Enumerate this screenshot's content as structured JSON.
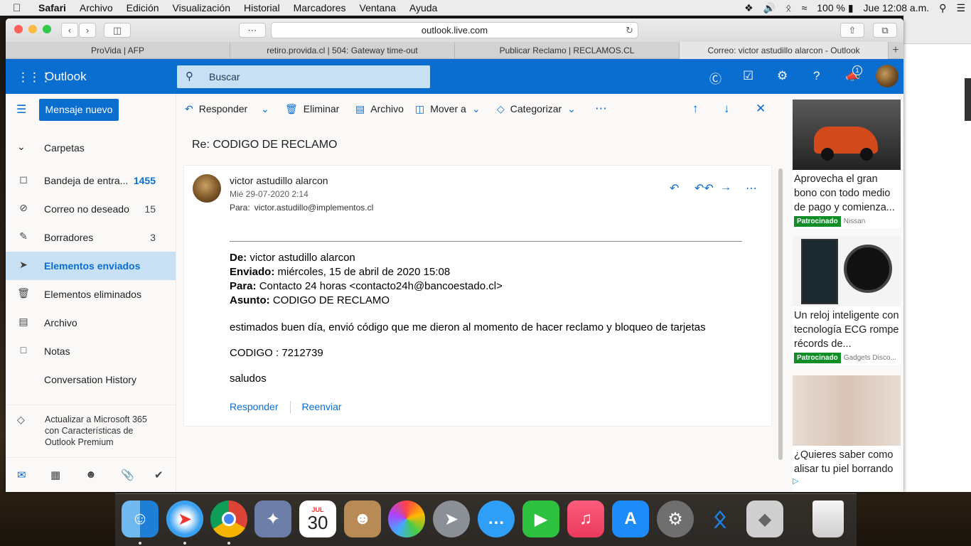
{
  "menubar": {
    "app": "Safari",
    "items": [
      "Archivo",
      "Edición",
      "Visualización",
      "Historial",
      "Marcadores",
      "Ventana",
      "Ayuda"
    ],
    "battery": "100 %",
    "clock": "Jue 12:08 a.m."
  },
  "browser": {
    "url": "outlook.live.com",
    "tabs": [
      {
        "label": "ProVida | AFP"
      },
      {
        "label": "retiro.provida.cl | 504: Gateway time-out"
      },
      {
        "label": "Publicar Reclamo | RECLAMOS.CL"
      },
      {
        "label": "Correo: victor astudillo alarcon - Outlook"
      }
    ]
  },
  "outlook": {
    "brand": "Outlook",
    "search_placeholder": "Buscar",
    "notification_count": "1",
    "new_message": "Mensaje nuevo",
    "folders_header": "Carpetas",
    "folders": [
      {
        "label": "Bandeja de entra...",
        "count": "1455"
      },
      {
        "label": "Correo no deseado",
        "count": "15"
      },
      {
        "label": "Borradores",
        "count": "3"
      },
      {
        "label": "Elementos enviados",
        "count": ""
      },
      {
        "label": "Elementos eliminados",
        "count": ""
      },
      {
        "label": "Archivo",
        "count": ""
      },
      {
        "label": "Notas",
        "count": ""
      },
      {
        "label": "Conversation History",
        "count": ""
      }
    ],
    "upgrade": "Actualizar a Microsoft 365 con Características de Outlook Premium",
    "commands": {
      "reply": "Responder",
      "delete": "Eliminar",
      "archive": "Archivo",
      "move": "Mover a",
      "categorize": "Categorizar"
    }
  },
  "message": {
    "subject": "Re: CODIGO DE RECLAMO",
    "sender": "victor astudillo alarcon",
    "date": "Mié 29-07-2020 2:14",
    "to_label": "Para:",
    "to": "victor.astudillo@implementos.cl",
    "quoted": {
      "from_label": "De:",
      "from": "victor astudillo alarcon",
      "sent_label": "Enviado:",
      "sent": "miércoles, 15 de abril de 2020 15:08",
      "to_label": "Para:",
      "to": "Contacto 24 horas <contacto24h@bancoestado.cl>",
      "subject_label": "Asunto:",
      "subject": "CODIGO DE RECLAMO"
    },
    "body": [
      "estimados buen día, envió código que me dieron al momento de hacer reclamo y bloqueo de tarjetas",
      "CODIGO : 7212739",
      "saludos"
    ],
    "reply_link": "Responder",
    "forward_link": "Reenviar"
  },
  "ads": [
    {
      "text": "Aprovecha el gran bono con todo medio de pago y comienza...",
      "sponsored": "Patrocinado",
      "advertiser": "Nissan"
    },
    {
      "text": "Un reloj inteligente con tecnología ECG rompe récords de...",
      "sponsored": "Patrocinado",
      "advertiser": "Gadgets Disco..."
    },
    {
      "text": "¿Quieres saber como alisar tu piel borrando",
      "sponsored": "",
      "advertiser": ""
    }
  ],
  "dock": {
    "calendar_month": "JUL",
    "calendar_day": "30"
  }
}
